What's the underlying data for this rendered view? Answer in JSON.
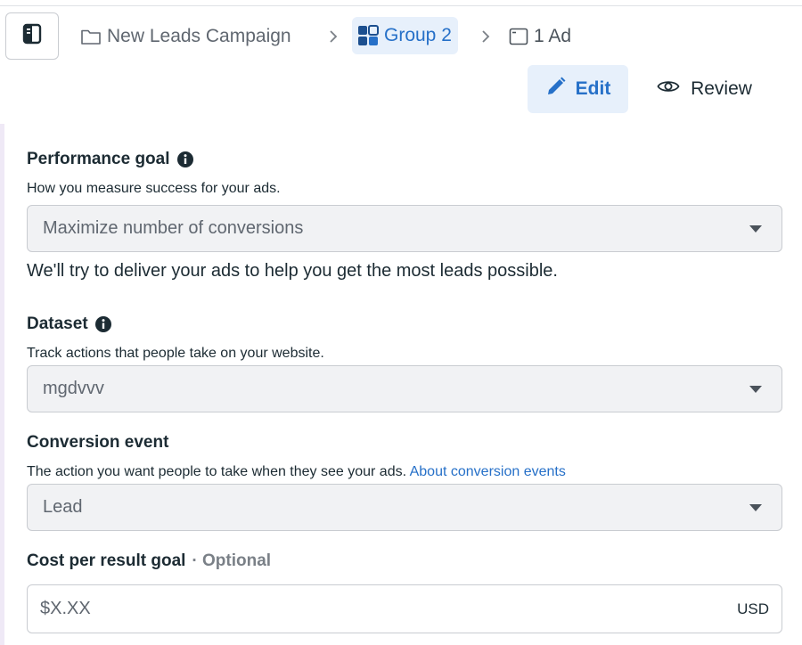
{
  "breadcrumb": {
    "campaign": "New Leads Campaign",
    "group": "Group 2",
    "ad": "1 Ad",
    "separator": ">"
  },
  "mode": {
    "edit_label": "Edit",
    "review_label": "Review"
  },
  "performance_goal": {
    "title": "Performance goal",
    "description": "How you measure success for your ads.",
    "selected": "Maximize number of conversions",
    "hint": "We'll try to deliver your ads to help you get the most leads possible."
  },
  "dataset": {
    "title": "Dataset",
    "description": "Track actions that people take on your website.",
    "selected": "mgdvvv"
  },
  "conversion_event": {
    "title": "Conversion event",
    "description": "The action you want people to take when they see your ads.",
    "link": "About conversion events",
    "selected": "Lead"
  },
  "cost_per_result": {
    "title": "Cost per result goal",
    "optional": "· Optional",
    "placeholder": "$X.XX",
    "currency": "USD"
  },
  "colors": {
    "accent": "#2670c8",
    "accent_bg": "#e7f0fb",
    "text": "#1c2b33",
    "muted": "#606770",
    "field_bg": "#f1f2f4",
    "border": "#c9ccd1"
  }
}
